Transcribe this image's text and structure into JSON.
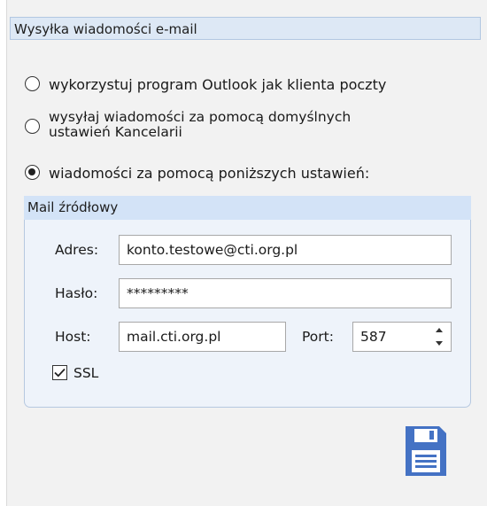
{
  "section": {
    "title": "Wysyłka wiadomości e-mail"
  },
  "options": [
    {
      "label": "wykorzystuj program Outlook jak klienta poczty",
      "checked": false
    },
    {
      "line1": "wysyłaj wiadomości za pomocą domyślnych",
      "line2": "ustawień Kancelarii",
      "checked": false
    },
    {
      "label": "wiadomości za pomocą poniższych ustawień:",
      "checked": true
    }
  ],
  "mail_source": {
    "title": "Mail źródłowy",
    "address_label": "Adres:",
    "address_value": "konto.testowe@cti.org.pl",
    "password_label": "Hasło:",
    "password_value": "*********",
    "host_label": "Host:",
    "host_value": "mail.cti.org.pl",
    "port_label": "Port:",
    "port_value": "587",
    "ssl_label": "SSL",
    "ssl_checked": true
  },
  "colors": {
    "save_icon": "#4472c4",
    "header_bg": "#dde8f5",
    "group_bg": "#eef3fa"
  },
  "icons": {
    "save": "floppy-disk-icon",
    "check": "check-icon"
  }
}
